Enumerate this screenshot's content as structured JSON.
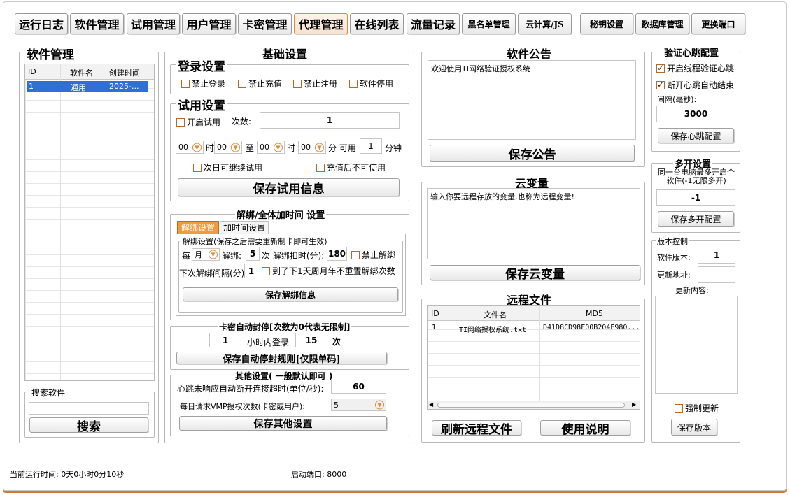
{
  "top_tabs": [
    "运行日志",
    "软件管理",
    "试用管理",
    "用户管理",
    "卡密管理",
    "代理管理",
    "在线列表",
    "流量记录",
    "黑名单管理",
    "云计算/JS",
    "秘钥设置",
    "数据库管理",
    "更换端口"
  ],
  "soft_panel": {
    "title": "软件管理",
    "columns": [
      "ID",
      "软件名",
      "创建时间"
    ],
    "rows": [
      [
        "1",
        "通用",
        "2025-..."
      ]
    ],
    "search_label": "搜索软件",
    "search_placeholder": "",
    "search_button": "搜索"
  },
  "basic": {
    "title": "基础设置",
    "login_title": "登录设置",
    "login_checks": [
      "禁止登录",
      "禁止充值",
      "禁止注册",
      "软件停用"
    ],
    "trial_title": "试用设置",
    "trial_enable": "开启试用",
    "count_label": "次数:",
    "count_value": "1",
    "time_hour1": "00",
    "time_min1": "00",
    "time_hour2": "00",
    "time_min2": "00",
    "t_shi": "时",
    "t_zhi": "至",
    "t_shi2": "时",
    "t_fen_use": "分 可用",
    "use_minutes": "1",
    "t_fenzhong": "分钟",
    "next_day": "次日可继续试用",
    "no_after_recharge": "充值后不可使用",
    "save_trial": "保存试用信息"
  },
  "unbind": {
    "title": "解绑/全体加时间 设置",
    "tab1": "解绑设置",
    "tab2": "加时间设置",
    "sub_title": "解绑设置(保存之后需要重新制卡即可生效)",
    "every": "每",
    "period": "月",
    "unbind_label": "解绑:",
    "unbind_count": "5",
    "deduct_label": "次 解绑扣时(分):",
    "deduct_value": "180",
    "forbid_unbind": "禁止解绑",
    "interval_label": "下次解绑间隔(分)",
    "interval_value": "1",
    "no_reset": "到了下1天周月年不重置解绑次数",
    "save": "保存解绑信息"
  },
  "autoban": {
    "title": "卡密自动封停[次数为0代表无限制]",
    "count": "1",
    "mid_label": "小时内登录",
    "times": "15",
    "unit": "次",
    "save": "保存自动停封规则[仅限单码]"
  },
  "other": {
    "title": "其他设置(  一般默认即可  )",
    "timeout_label": "心跳未响应自动断开连接超时(单位/秒):",
    "timeout_value": "60",
    "vmp_label": "每日请求VMP授权次数(卡密或用户):",
    "vmp_value": "5",
    "save": "保存其他设置"
  },
  "notice": {
    "title": "软件公告",
    "content": "欢迎使用TI网络验证授权系统",
    "save": "保存公告"
  },
  "cloudvar": {
    "title": "云变量",
    "content": "输入你要远程存放的变量,也称为远程变量!",
    "save": "保存云变量"
  },
  "remote": {
    "title": "远程文件",
    "columns": [
      "ID",
      "文件名",
      "MD5"
    ],
    "rows": [
      [
        "1",
        "TI网络授权系统.txt",
        "D41D8CD98F00B204E980..."
      ]
    ],
    "refresh": "刷新远程文件",
    "help": "使用说明"
  },
  "heartbeat": {
    "title": "验证心跳配置",
    "opt1": "开启线程验证心跳",
    "opt2": "断开心跳自动结束",
    "interval_label": "间隔(毫秒):",
    "interval_value": "3000",
    "save": "保存心跳配置"
  },
  "multi": {
    "title": "多开设置",
    "desc": "同一台电脑最多开启个软件(-1无限多开)",
    "value": "-1",
    "save": "保存多开配置"
  },
  "version": {
    "title": "版本控制",
    "ver_label": "软件版本:",
    "ver_value": "1",
    "url_label": "更新地址:",
    "content_label": "更新内容:",
    "force": "强制更新",
    "save": "保存版本"
  },
  "status": {
    "runtime": "当前运行时间: 0天0小时0分10秒",
    "port": "启动端口: 8000"
  }
}
